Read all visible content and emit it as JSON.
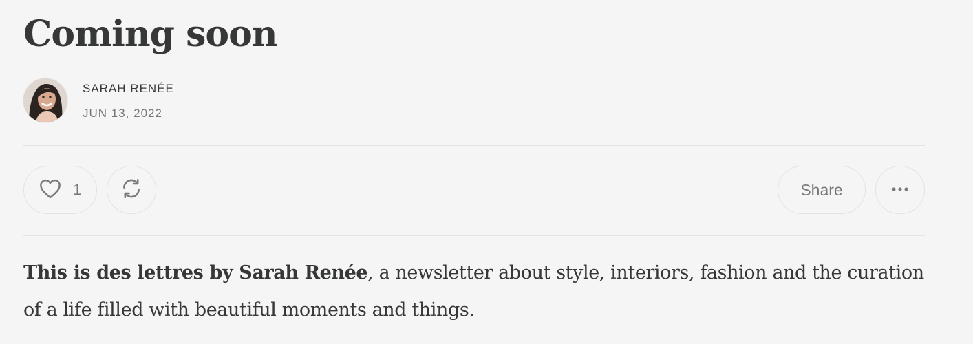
{
  "post": {
    "title": "Coming soon",
    "author": "Sarah Renée",
    "date": "Jun 13, 2022",
    "likes": "1",
    "share_label": "Share",
    "intro_bold": "This is des lettres by Sarah Renée",
    "intro_rest": ", a newsletter about style, interiors, fashion and the curation of a life filled with beautiful moments and things."
  },
  "icons": {
    "like": "heart-icon",
    "restack": "restack-icon",
    "more": "ellipsis-icon"
  },
  "colors": {
    "background": "#f5f5f5",
    "text": "#363737",
    "muted": "#777777",
    "border": "#e3e3e3"
  }
}
